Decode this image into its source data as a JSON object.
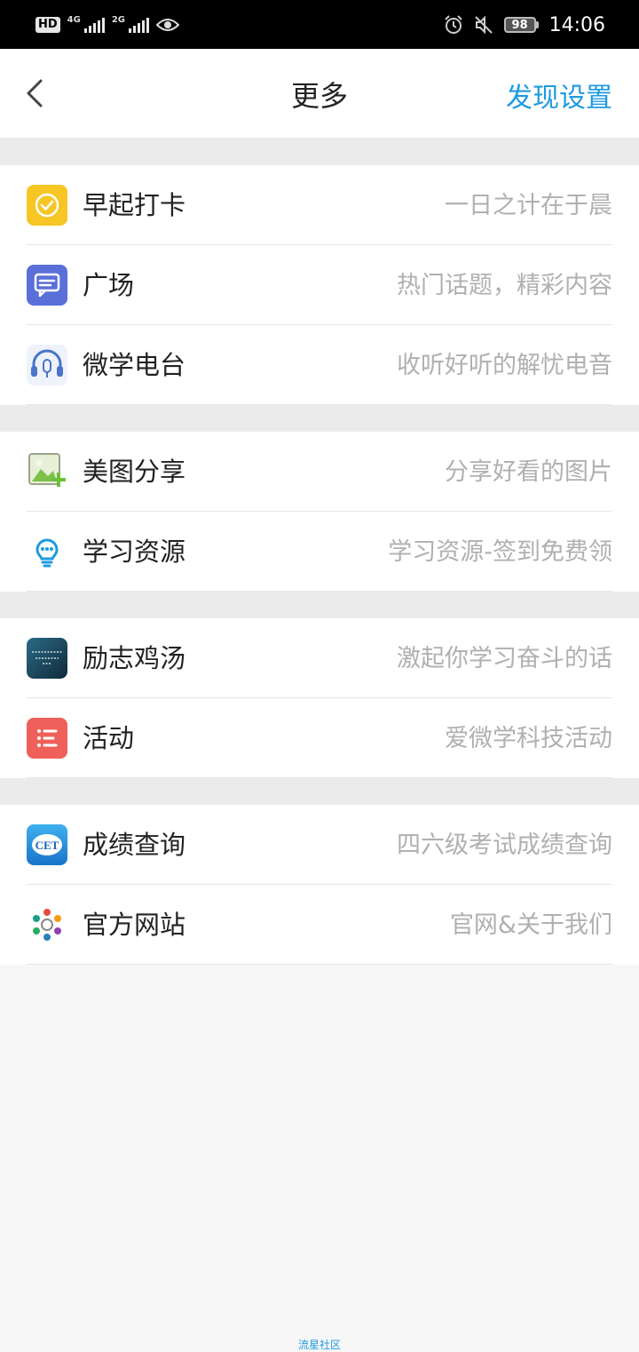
{
  "status_bar": {
    "hd_label": "HD",
    "net1_label": "4G",
    "net2_label": "2G",
    "battery_level": "98",
    "time": "14:06"
  },
  "nav": {
    "title": "更多",
    "right_action": "发现设置"
  },
  "sections": [
    {
      "items": [
        {
          "title": "早起打卡",
          "subtitle": "一日之计在于晨",
          "icon": "checkin-clock-icon",
          "color": "#f6c624"
        },
        {
          "title": "广场",
          "subtitle": "热门话题，精彩内容",
          "icon": "chat-bubble-icon",
          "color": "#5b6fd8"
        },
        {
          "title": "微学电台",
          "subtitle": "收听好听的解忧电音",
          "icon": "headphones-icon",
          "color": "#4a73c9"
        }
      ]
    },
    {
      "items": [
        {
          "title": "美图分享",
          "subtitle": "分享好看的图片",
          "icon": "image-add-icon",
          "color": "#7cc24a"
        },
        {
          "title": "学习资源",
          "subtitle": "学习资源-签到免费领",
          "icon": "lightbulb-icon",
          "color": "#1e9ae0"
        }
      ]
    },
    {
      "items": [
        {
          "title": "励志鸡汤",
          "subtitle": "激起你学习奋斗的话",
          "icon": "quote-image-icon",
          "color": "#1d4c63"
        },
        {
          "title": "活动",
          "subtitle": "爱微学科技活动",
          "icon": "list-icon",
          "color": "#f0605a"
        }
      ]
    },
    {
      "items": [
        {
          "title": "成绩查询",
          "subtitle": "四六级考试成绩查询",
          "icon": "cet-logo-icon",
          "color": "#1e8fd8"
        },
        {
          "title": "官方网站",
          "subtitle": "官网&关于我们",
          "icon": "flower-logo-icon",
          "color": "#e84c3d"
        }
      ]
    }
  ],
  "footer": {
    "text": "流星社区"
  }
}
